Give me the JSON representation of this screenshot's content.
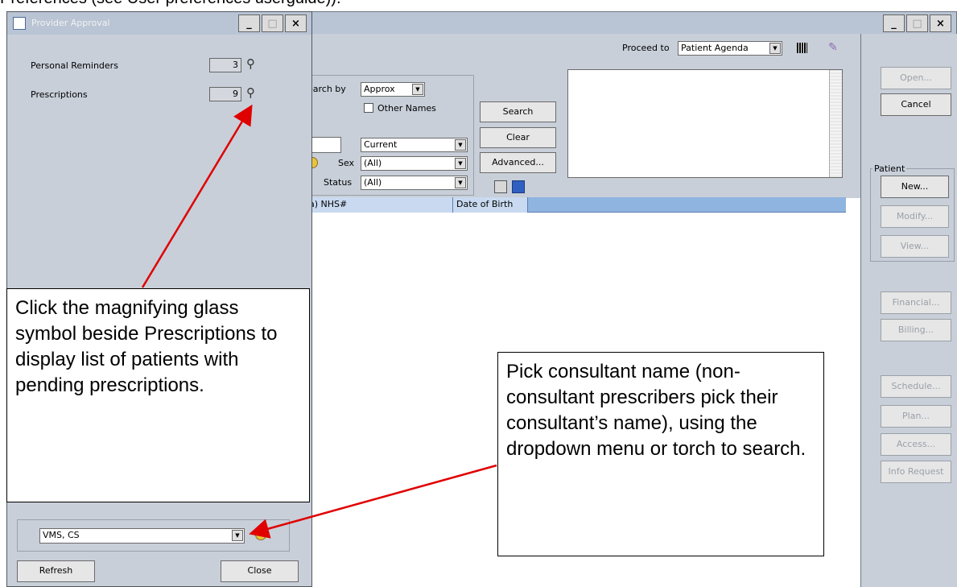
{
  "top_text": "Preferences (see User preferences userguide)).",
  "main_window": {
    "window_buttons": [
      "_",
      "□",
      "×"
    ],
    "proceed_label": "Proceed to",
    "proceed_value": "Patient Agenda",
    "search_by_label": "earch by",
    "search_by_value": "Approx",
    "other_names_label": "Other Names",
    "search_label": "Search",
    "clear_label": "Clear",
    "advanced_label": "Advanced...",
    "current_value": "Current",
    "sex_label": "Sex",
    "sex_value": "(All)",
    "status_label": "Status",
    "status_value": "(All)",
    "grid_columns": [
      "a) NHS#",
      "Date of Birth"
    ],
    "right_buttons": {
      "open": "Open...",
      "cancel": "Cancel",
      "patient_group": "Patient",
      "new": "New...",
      "modify": "Modify...",
      "view": "View...",
      "financial": "Financial...",
      "billing": "Billing...",
      "schedule": "Schedule...",
      "plan": "Plan...",
      "access": "Access...",
      "info_request": "Info Request"
    }
  },
  "dialog": {
    "title": "Provider Approval",
    "window_buttons": [
      "_",
      "□",
      "×"
    ],
    "rows": [
      {
        "label": "Personal Reminders",
        "value": "3"
      },
      {
        "label": "Prescriptions",
        "value": "9"
      }
    ],
    "provider_value": "VMS, CS",
    "refresh_label": "Refresh",
    "close_label": "Close"
  },
  "callouts": {
    "left": "Click the magnifying glass symbol beside Prescriptions to display list of patients with pending prescriptions.",
    "right": "Pick consultant name (non-consultant prescribers pick their consultant’s name), using the dropdown menu or torch to search."
  },
  "colors": {
    "arrow": "#e00000",
    "title_bar": "#b9c4d4",
    "panel": "#c8cfd9"
  }
}
